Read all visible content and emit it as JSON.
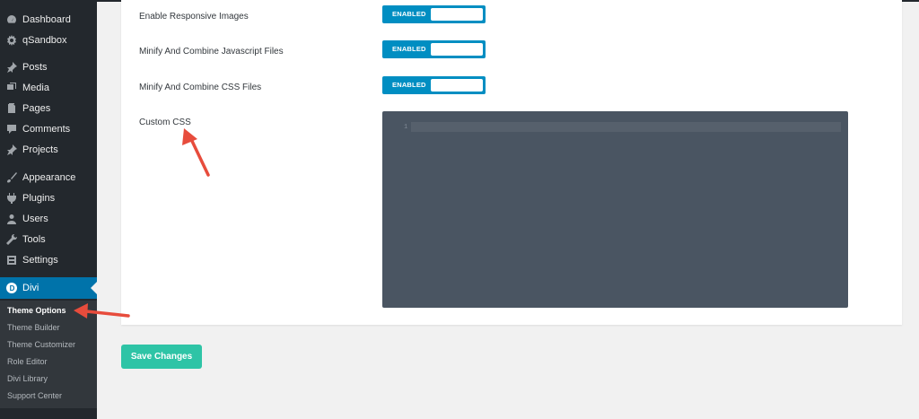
{
  "sidebar": {
    "items": [
      {
        "label": "Dashboard",
        "icon": "dashboard-icon"
      },
      {
        "label": "qSandbox",
        "icon": "gear-icon"
      },
      {
        "label": "Posts",
        "icon": "pin-icon"
      },
      {
        "label": "Media",
        "icon": "media-icon"
      },
      {
        "label": "Pages",
        "icon": "pages-icon"
      },
      {
        "label": "Comments",
        "icon": "comment-icon"
      },
      {
        "label": "Projects",
        "icon": "pin-icon"
      },
      {
        "label": "Appearance",
        "icon": "brush-icon"
      },
      {
        "label": "Plugins",
        "icon": "plug-icon"
      },
      {
        "label": "Users",
        "icon": "user-icon"
      },
      {
        "label": "Tools",
        "icon": "wrench-icon"
      },
      {
        "label": "Settings",
        "icon": "settings-icon"
      }
    ],
    "divi": {
      "label": "Divi",
      "icon": "divi-logo-icon"
    },
    "submenu": [
      "Theme Options",
      "Theme Builder",
      "Theme Customizer",
      "Role Editor",
      "Divi Library",
      "Support Center"
    ]
  },
  "options": {
    "responsive_images": {
      "label": "Enable Responsive Images",
      "state": "ENABLED"
    },
    "minify_js": {
      "label": "Minify And Combine Javascript Files",
      "state": "ENABLED"
    },
    "minify_css": {
      "label": "Minify And Combine CSS Files",
      "state": "ENABLED"
    },
    "custom_css": {
      "label": "Custom CSS",
      "line_number": "1"
    }
  },
  "save_button": "Save Changes",
  "colors": {
    "sidebar": "#23282d",
    "accent": "#0073aa",
    "toggle": "#008ec2",
    "save": "#2ec4a6",
    "annotation": "#e74c3c"
  }
}
